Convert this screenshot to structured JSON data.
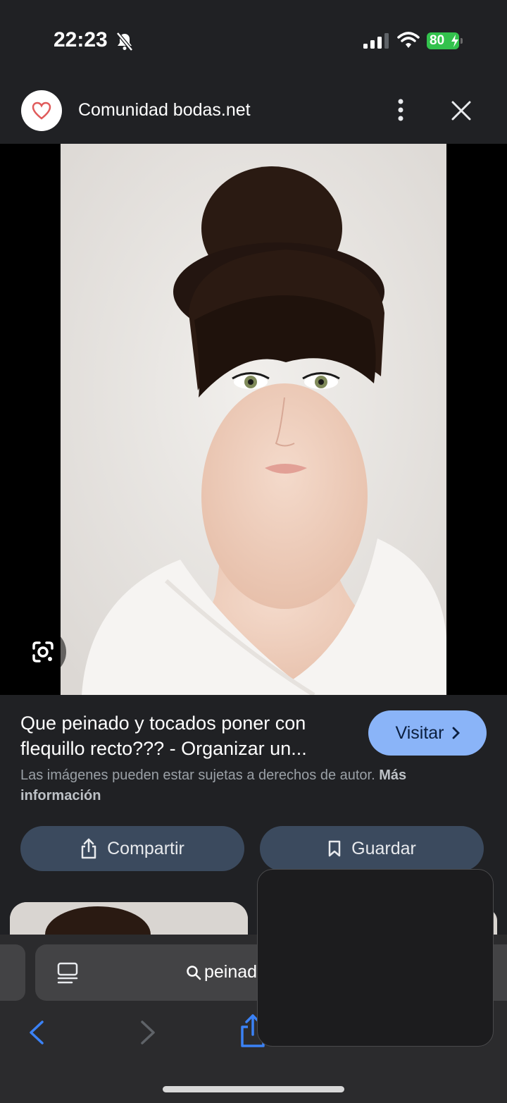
{
  "status_bar": {
    "time": "22:23",
    "battery": "80",
    "icons": [
      "bell-off-icon",
      "signal-icon",
      "wifi-icon",
      "battery-charging-icon"
    ],
    "battery_color": "#33c24d"
  },
  "header": {
    "site_name": "Comunidad bodas.net",
    "logo_icon": "heart-icon",
    "logo_color": "#e05a5a",
    "more_icon": "more-vert-icon",
    "close_icon": "close-icon"
  },
  "image": {
    "lens_icon": "google-lens-icon"
  },
  "result": {
    "title": "Que peinado y tocados poner con flequillo recto??? - Organizar un...",
    "visit_label": "Visitar",
    "copyright_text": "Las imágenes pueden estar sujetas a derechos de autor.",
    "copyright_link": "Más información",
    "share_label": "Compartir",
    "save_label": "Guardar",
    "accent_color": "#8ab4f8"
  },
  "browser": {
    "search_query": "peinados fl",
    "nav_icons": [
      "back-arrow-icon",
      "forward-arrow-icon",
      "share-icon"
    ],
    "link_color": "#3b82f6"
  }
}
